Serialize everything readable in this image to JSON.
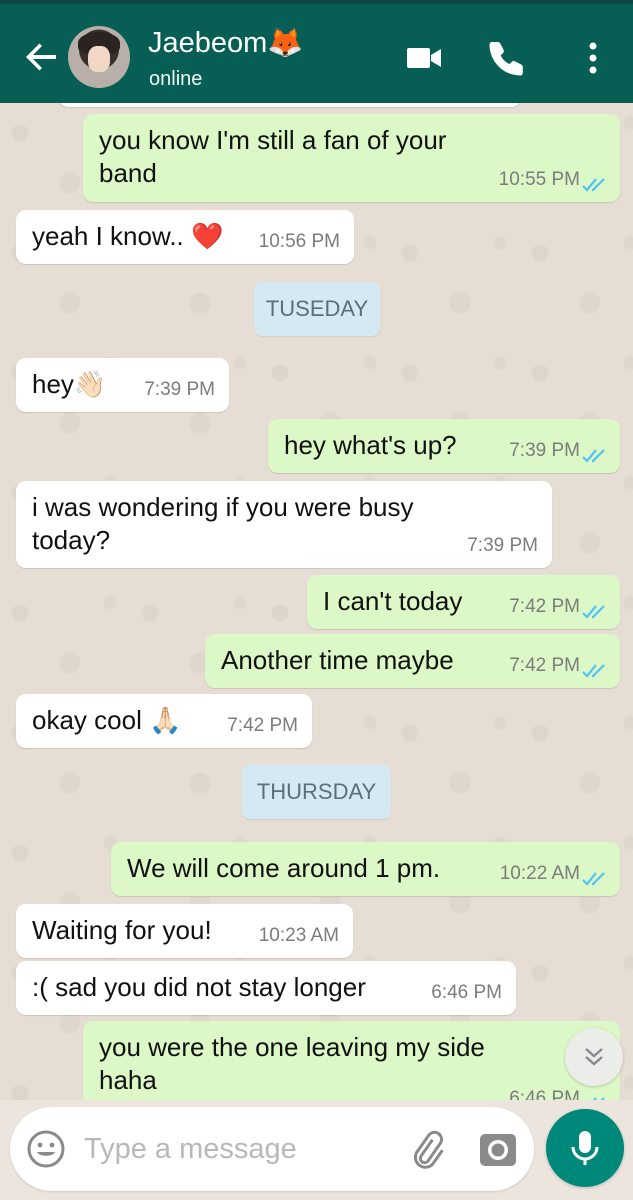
{
  "header": {
    "contact_name": "Jaebeom🦊",
    "status": "online"
  },
  "messages": [
    {
      "dir": "out",
      "text": "you know I'm still a fan of your\nband",
      "time": "10:55 PM",
      "ticks": "read"
    },
    {
      "dir": "in",
      "text": "yeah I know.. ❤️",
      "time": "10:56 PM"
    },
    {
      "type": "day",
      "text": "TUSEDAY"
    },
    {
      "dir": "in",
      "text": "hey👋🏻",
      "time": "7:39 PM"
    },
    {
      "dir": "out",
      "text": "hey what's up?",
      "time": "7:39 PM",
      "ticks": "read"
    },
    {
      "dir": "in",
      "text": "i was wondering if you were busy\ntoday?",
      "time": "7:39 PM"
    },
    {
      "dir": "out",
      "text": "I can't today",
      "time": "7:42 PM",
      "ticks": "read"
    },
    {
      "dir": "out",
      "text": "Another time maybe",
      "time": "7:42 PM",
      "ticks": "read"
    },
    {
      "dir": "in",
      "text": "okay cool 🙏🏻",
      "time": "7:42 PM"
    },
    {
      "type": "day",
      "text": "THURSDAY"
    },
    {
      "dir": "out",
      "text": "We will come around 1 pm.",
      "time": "10:22 AM",
      "ticks": "read"
    },
    {
      "dir": "in",
      "text": "Waiting for you!",
      "time": "10:23 AM"
    },
    {
      "dir": "in",
      "text": ":( sad you did not stay longer",
      "time": "6:46 PM"
    },
    {
      "dir": "out",
      "text": "you were the one leaving my side\nhaha",
      "time": "6:46 PM",
      "ticks": "read"
    }
  ],
  "composer": {
    "placeholder": "Type a message"
  },
  "colors": {
    "header": "#075e54",
    "outgoing_bubble": "#dcf8c6",
    "incoming_bubble": "#ffffff",
    "read_ticks": "#4fc3f7",
    "mic_button": "#00897b",
    "day_pill": "#d5e9f3"
  },
  "icons": {
    "back": "back-arrow-icon",
    "video": "video-call-icon",
    "call": "phone-icon",
    "menu": "more-vert-icon",
    "emoji": "emoji-icon",
    "attach": "paperclip-icon",
    "camera": "camera-icon",
    "mic": "mic-icon",
    "scroll": "chevron-double-down-icon"
  }
}
